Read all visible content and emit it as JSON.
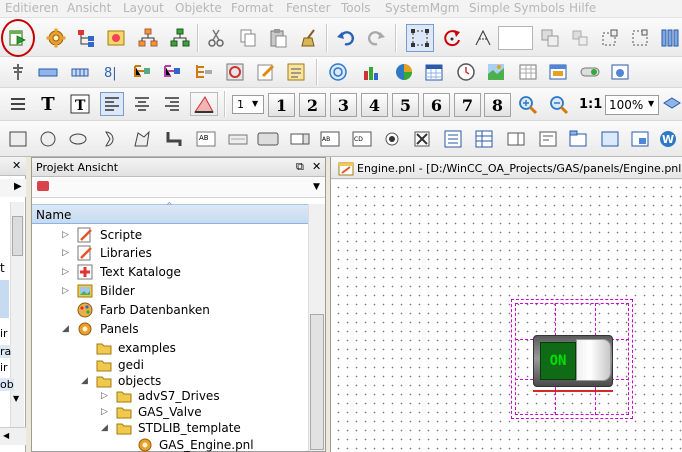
{
  "menu": [
    "Editieren",
    "Ansicht",
    "Layout",
    "Objekte",
    "Format",
    "Fenster",
    "Tools",
    "SystemMgm",
    "Simple Symbols",
    "Hilfe"
  ],
  "toolbar": {
    "line_width_options": [
      "1"
    ],
    "line_width_value": "1",
    "number_buttons": [
      "1",
      "2",
      "3",
      "4",
      "5",
      "6",
      "7",
      "8"
    ],
    "zoom_value": "100%",
    "zoom_one_label": "1:1",
    "text_tool_label": "T"
  },
  "project_pane": {
    "title": "Projekt Ansicht",
    "column_header": "Name",
    "tree": [
      {
        "label": "Scripte",
        "expander": "closed",
        "icon": "script-icon"
      },
      {
        "label": "Libraries",
        "expander": "closed",
        "icon": "library-icon"
      },
      {
        "label": "Text Kataloge",
        "expander": "closed",
        "icon": "text-catalog-icon"
      },
      {
        "label": "Bilder",
        "expander": "closed",
        "icon": "image-folder-icon"
      },
      {
        "label": "Farb Datenbanken",
        "expander": "none",
        "icon": "color-db-icon"
      },
      {
        "label": "Panels",
        "expander": "open",
        "icon": "panels-icon"
      },
      {
        "label": "examples",
        "expander": "none",
        "icon": "folder-icon"
      },
      {
        "label": "gedi",
        "expander": "none",
        "icon": "folder-icon"
      },
      {
        "label": "objects",
        "expander": "open",
        "icon": "folder-icon"
      },
      {
        "label": "advS7_Drives",
        "expander": "closed",
        "icon": "folder-icon"
      },
      {
        "label": "GAS_Valve",
        "expander": "closed",
        "icon": "folder-icon"
      },
      {
        "label": "STDLIB_template",
        "expander": "open",
        "icon": "folder-icon"
      },
      {
        "label": "GAS_Engine.pnl",
        "expander": "none",
        "icon": "panel-file-icon"
      }
    ]
  },
  "left_strip": {
    "fragments": [
      "t",
      "ir",
      "ra",
      "ir",
      "ob"
    ]
  },
  "editor": {
    "tab_title": "Engine.pnl - [D:/WinCC_OA_Projects/GAS/panels/Engine.pnl]",
    "widget_label": "ON"
  },
  "colors": {
    "highlight_circle": "#c40000",
    "selection_magenta": "#d000d0",
    "widget_green": "#0f6b16",
    "widget_text_green": "#00e000"
  }
}
